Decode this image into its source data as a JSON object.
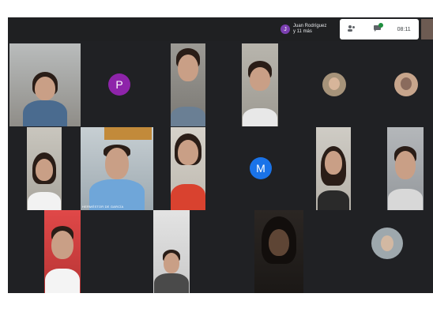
{
  "meet": {
    "speaker": {
      "initial": "J",
      "name_line1": "Juan Rodríguez",
      "name_line2": "y 11 más"
    },
    "toolbar": {
      "people_count": "",
      "chat_label": "",
      "time": "08:11"
    }
  },
  "participants": [
    {
      "id": "woman-glasses",
      "type": "camera"
    },
    {
      "id": "p-avatar",
      "type": "letter",
      "letter": "P",
      "color": "#8e24aa"
    },
    {
      "id": "boy-1",
      "type": "camera"
    },
    {
      "id": "boy-2",
      "type": "camera"
    },
    {
      "id": "round-1",
      "type": "round"
    },
    {
      "id": "round-2",
      "type": "round"
    },
    {
      "id": "girl-1",
      "type": "camera"
    },
    {
      "id": "teacher",
      "type": "camera",
      "name": "HERMÉSTOR DE GARCÍA"
    },
    {
      "id": "girl-2",
      "type": "camera"
    },
    {
      "id": "m-avatar",
      "type": "letter",
      "letter": "M",
      "color": "#1a73e8"
    },
    {
      "id": "girl-3",
      "type": "camera"
    },
    {
      "id": "girl-4",
      "type": "camera"
    },
    {
      "id": "boy-3",
      "type": "camera"
    },
    {
      "id": "boy-4",
      "type": "camera"
    },
    {
      "id": "dark-girl",
      "type": "camera"
    },
    {
      "id": "round-3",
      "type": "round"
    }
  ]
}
